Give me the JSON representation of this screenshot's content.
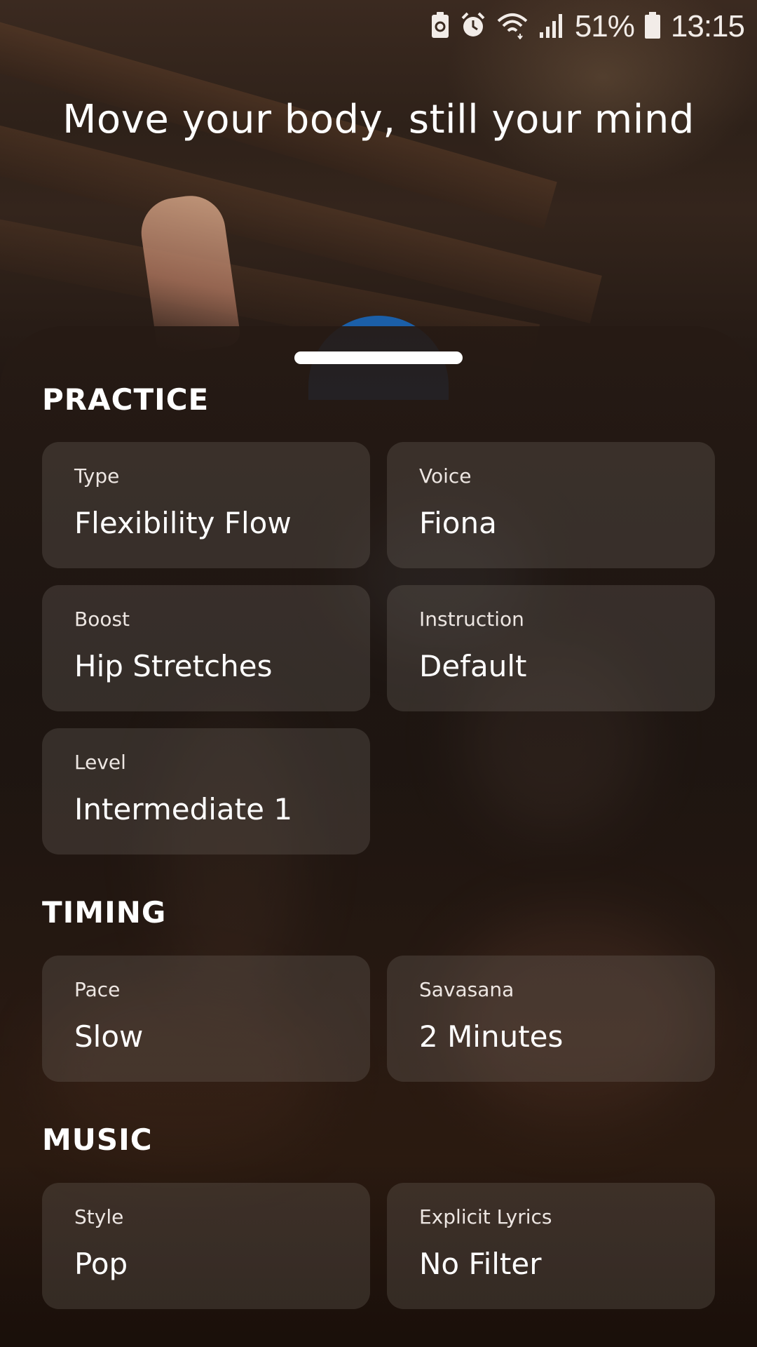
{
  "status_bar": {
    "battery_percent": "51%",
    "time": "13:15",
    "icons": [
      "recycle-battery-icon",
      "alarm-icon",
      "wifi-icon",
      "signal-icon",
      "battery-icon"
    ]
  },
  "headline": "Move your body, still your mind",
  "sections": {
    "practice": {
      "title": "PRACTICE",
      "type": {
        "label": "Type",
        "value": "Flexibility Flow"
      },
      "voice": {
        "label": "Voice",
        "value": "Fiona"
      },
      "boost": {
        "label": "Boost",
        "value": "Hip Stretches"
      },
      "instruction": {
        "label": "Instruction",
        "value": "Default"
      },
      "level": {
        "label": "Level",
        "value": "Intermediate 1"
      }
    },
    "timing": {
      "title": "TIMING",
      "pace": {
        "label": "Pace",
        "value": "Slow"
      },
      "savasana": {
        "label": "Savasana",
        "value": "2 Minutes"
      }
    },
    "music": {
      "title": "MUSIC",
      "style": {
        "label": "Style",
        "value": "Pop"
      },
      "explicit_lyrics": {
        "label": "Explicit Lyrics",
        "value": "No Filter"
      }
    }
  }
}
